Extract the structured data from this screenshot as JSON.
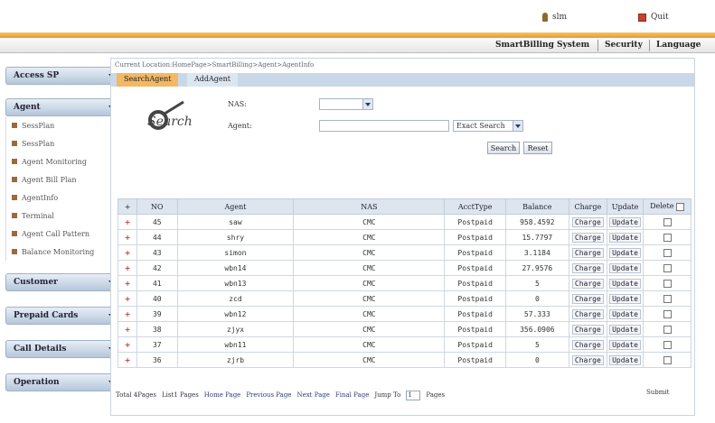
{
  "header": {
    "user_label": "slm",
    "quit_label": "Quit"
  },
  "menu": [
    {
      "key": "smartbilling",
      "label": "SmartBilling System"
    },
    {
      "key": "security",
      "label": "Security"
    },
    {
      "key": "language",
      "label": "Language"
    }
  ],
  "sidebar": {
    "sections": [
      {
        "label": "Access SP"
      },
      {
        "label": "Agent",
        "items": [
          "SessPlan",
          "SessPlan",
          "Agent Monitoring",
          "Agent Bill Plan",
          "AgentInfo",
          "Terminal",
          "Agent Call Pattern",
          "Balance Monitoring"
        ]
      },
      {
        "label": "Customer"
      },
      {
        "label": "Prepaid Cards"
      },
      {
        "label": "Call Details"
      },
      {
        "label": "Operation"
      }
    ]
  },
  "breadcrumb": "Current Location:HomePage>SmartBilling>Agent>AgentInfo",
  "tabs": [
    "SearchAgent",
    "AddAgent"
  ],
  "form": {
    "logo_text": "Search",
    "nas_label": "NAS:",
    "agent_label": "Agent:",
    "match_value": "Exact Search",
    "search_btn": "Search",
    "reset_btn": "Reset"
  },
  "table": {
    "headers": [
      "+",
      "NO",
      "Agent",
      "NAS",
      "AcctType",
      "Balance",
      "Charge",
      "Update",
      "Delete"
    ],
    "rows": [
      [
        "+",
        "45",
        "saw",
        "CMC",
        "Postpaid",
        "958.4592",
        "Charge",
        "Update"
      ],
      [
        "+",
        "44",
        "shry",
        "CMC",
        "Postpaid",
        "15.7797",
        "Charge",
        "Update"
      ],
      [
        "+",
        "43",
        "simon",
        "CMC",
        "Postpaid",
        "3.1184",
        "Charge",
        "Update"
      ],
      [
        "+",
        "42",
        "wbn14",
        "CMC",
        "Postpaid",
        "27.9576",
        "Charge",
        "Update"
      ],
      [
        "+",
        "41",
        "wbn13",
        "CMC",
        "Postpaid",
        "5",
        "Charge",
        "Update"
      ],
      [
        "+",
        "40",
        "zcd",
        "CMC",
        "Postpaid",
        "0",
        "Charge",
        "Update"
      ],
      [
        "+",
        "39",
        "wbn12",
        "CMC",
        "Postpaid",
        "57.333",
        "Charge",
        "Update"
      ],
      [
        "+",
        "38",
        "zjyx",
        "CMC",
        "Postpaid",
        "356.0906",
        "Charge",
        "Update"
      ],
      [
        "+",
        "37",
        "wbn11",
        "CMC",
        "Postpaid",
        "5",
        "Charge",
        "Update"
      ],
      [
        "+",
        "36",
        "zjrb",
        "CMC",
        "Postpaid",
        "0",
        "Charge",
        "Update"
      ]
    ]
  },
  "pager": {
    "total": "Total 4Pages",
    "list": "List1 Pages",
    "home": "Home Page",
    "prev": "Previous Page",
    "next": "Next Page",
    "final": "Final Page",
    "jump": "Jump To",
    "jump_value": "1",
    "pages": "Pages",
    "submit": "Submit"
  }
}
